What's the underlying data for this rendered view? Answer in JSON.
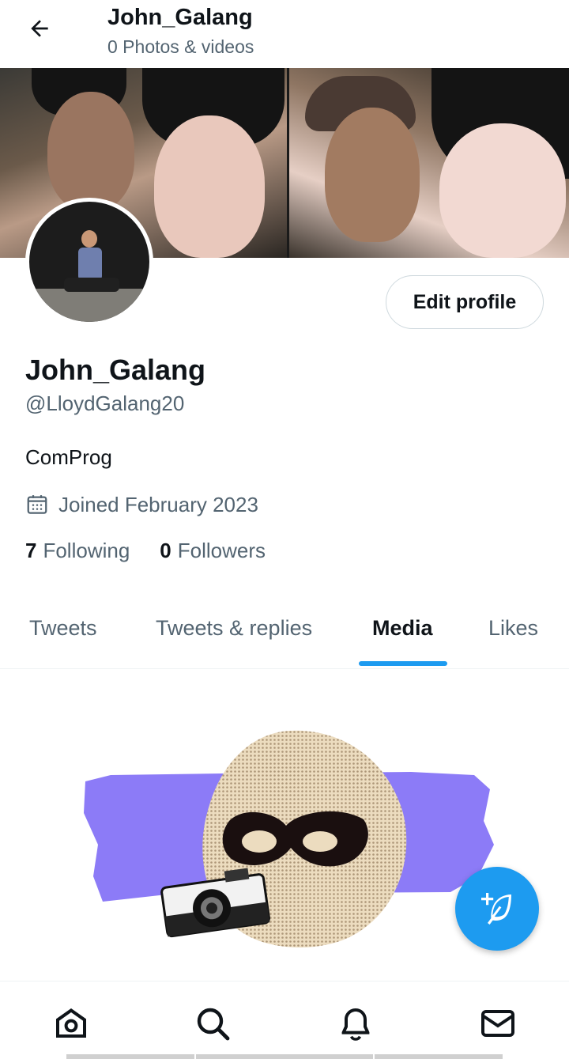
{
  "header": {
    "title": "John_Galang",
    "subtitle": "0 Photos & videos",
    "back_icon": "arrow-left-icon"
  },
  "profile": {
    "display_name": "John_Galang",
    "handle": "@LloydGalang20",
    "bio": "ComProg",
    "joined": "Joined February 2023",
    "following_count": "7",
    "following_label": "Following",
    "followers_count": "0",
    "followers_label": "Followers",
    "edit_button_label": "Edit profile"
  },
  "tabs": [
    {
      "label": "Tweets",
      "active": false
    },
    {
      "label": "Tweets & replies",
      "active": false
    },
    {
      "label": "Media",
      "active": true
    },
    {
      "label": "Likes",
      "active": false
    }
  ],
  "bottom_nav": [
    {
      "icon": "home-icon"
    },
    {
      "icon": "search-icon"
    },
    {
      "icon": "bell-icon"
    },
    {
      "icon": "mail-icon"
    }
  ],
  "fab": {
    "icon": "compose-tweet-icon"
  },
  "colors": {
    "accent": "#1d9bf0",
    "text_primary": "#0f1419",
    "text_secondary": "#536471",
    "illustration_purple": "#8c7bf7"
  }
}
